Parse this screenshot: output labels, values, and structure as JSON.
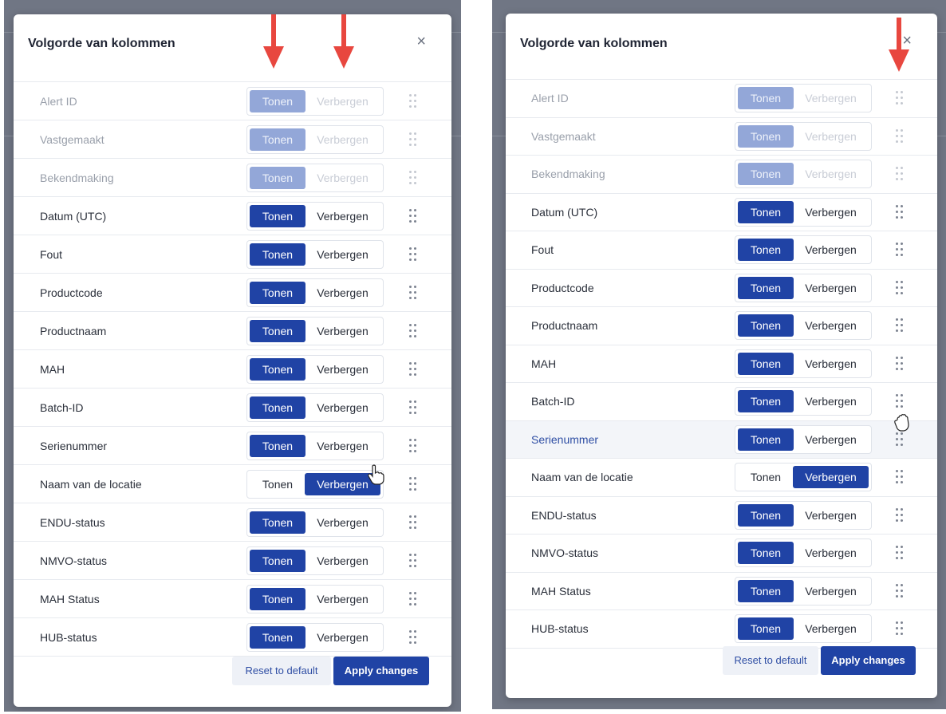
{
  "dialog_title": "Volgorde van kolommen",
  "close_label": "×",
  "show_label": "Tonen",
  "hide_label": "Verbergen",
  "footer": {
    "reset_label": "Reset to default",
    "apply_label": "Apply changes"
  },
  "colors": {
    "accent": "#2043a5",
    "accent_disabled": "#93a7d8",
    "annotation_arrow": "#e8473f"
  },
  "icons": {
    "close": "close-icon",
    "drag": "drag-handle-icon",
    "arrow": "red-arrow-icon",
    "cursor": "hand-pointer-icon"
  },
  "left": {
    "rows": [
      {
        "label": "Alert ID",
        "state": "show",
        "fixed": true
      },
      {
        "label": "Vastgemaakt",
        "state": "show",
        "fixed": true
      },
      {
        "label": "Bekendmaking",
        "state": "show",
        "fixed": true
      },
      {
        "label": "Datum (UTC)",
        "state": "show",
        "fixed": false
      },
      {
        "label": "Fout",
        "state": "show",
        "fixed": false
      },
      {
        "label": "Productcode",
        "state": "show",
        "fixed": false
      },
      {
        "label": "Productnaam",
        "state": "show",
        "fixed": false
      },
      {
        "label": "MAH",
        "state": "show",
        "fixed": false
      },
      {
        "label": "Batch-ID",
        "state": "show",
        "fixed": false
      },
      {
        "label": "Serienummer",
        "state": "show",
        "fixed": false
      },
      {
        "label": "Naam van de locatie",
        "state": "hide",
        "fixed": false
      },
      {
        "label": "ENDU-status",
        "state": "show",
        "fixed": false
      },
      {
        "label": "NMVO-status",
        "state": "show",
        "fixed": false
      },
      {
        "label": "MAH Status",
        "state": "show",
        "fixed": false
      },
      {
        "label": "HUB-status",
        "state": "show",
        "fixed": false
      }
    ]
  },
  "right": {
    "rows": [
      {
        "label": "Alert ID",
        "state": "show",
        "fixed": true
      },
      {
        "label": "Vastgemaakt",
        "state": "show",
        "fixed": true
      },
      {
        "label": "Bekendmaking",
        "state": "show",
        "fixed": true
      },
      {
        "label": "Datum (UTC)",
        "state": "show",
        "fixed": false
      },
      {
        "label": "Fout",
        "state": "show",
        "fixed": false
      },
      {
        "label": "Productcode",
        "state": "show",
        "fixed": false
      },
      {
        "label": "Productnaam",
        "state": "show",
        "fixed": false
      },
      {
        "label": "MAH",
        "state": "show",
        "fixed": false
      },
      {
        "label": "Batch-ID",
        "state": "show",
        "fixed": false
      },
      {
        "label": "Serienummer",
        "state": "show",
        "fixed": false,
        "hover": true
      },
      {
        "label": "Naam van de locatie",
        "state": "hide",
        "fixed": false
      },
      {
        "label": "ENDU-status",
        "state": "show",
        "fixed": false
      },
      {
        "label": "NMVO-status",
        "state": "show",
        "fixed": false
      },
      {
        "label": "MAH Status",
        "state": "show",
        "fixed": false
      },
      {
        "label": "HUB-status",
        "state": "show",
        "fixed": false
      }
    ]
  }
}
